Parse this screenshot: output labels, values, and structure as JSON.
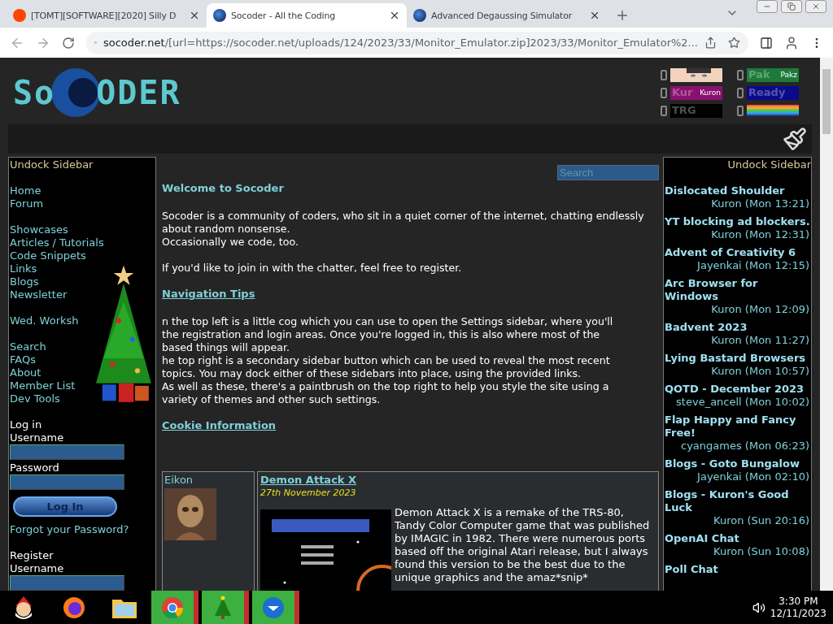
{
  "browser": {
    "tabs": [
      {
        "title": "[TOMT][SOFTWARE][2020] Silly D",
        "kind": "reddit",
        "selected": false
      },
      {
        "title": "Socoder - All the Coding",
        "kind": "socoder",
        "selected": true
      },
      {
        "title": "Advanced Degaussing Simulator",
        "kind": "socoder",
        "selected": false
      }
    ],
    "address": {
      "host": "socoder.net",
      "path": "/[url=https://socoder.net/uploads/124/2023/33/Monitor_Emulator.zip]2023/33/Monitor_Emulator%2..."
    }
  },
  "header": {
    "logo": {
      "left": "So",
      "right": "ODER"
    },
    "badges": [
      {
        "kind": "picture"
      },
      {
        "kind": "label",
        "main": "Pak",
        "sub": "Pakz",
        "color": "#1e7a3a"
      },
      {
        "kind": "label",
        "main": "Kur",
        "sub": "Kuron",
        "color": "#8a1070"
      },
      {
        "kind": "label",
        "main": "Ready",
        "color": "#0a0a8a"
      },
      {
        "kind": "label",
        "main": "TRG",
        "color": "#000000"
      },
      {
        "kind": "gradient"
      }
    ]
  },
  "left_sidebar": {
    "undock": "Undock Sidebar",
    "groups": [
      [
        "Home",
        "Forum"
      ],
      [
        "Showcases",
        "Articles / Tutorials",
        "Code Snippets",
        "Links",
        "Blogs",
        "Newsletter"
      ],
      [
        "Wed. Worksh"
      ],
      [
        "Search",
        "FAQs",
        "About",
        "Member List",
        "Dev Tools"
      ]
    ],
    "login": {
      "title": "Log in",
      "username_label": "Username",
      "password_label": "Password",
      "button": "Log In",
      "forgot": "Forgot your Password?"
    },
    "register": {
      "title": "Register",
      "username_label": "Username"
    }
  },
  "main": {
    "search": {
      "placeholder": "Search"
    },
    "welcome": {
      "heading": "Welcome to Socoder",
      "lines": [
        "Socoder is a community of coders, who sit in a quiet corner of the internet, chatting endlessly about random nonsense.",
        "Occasionally we code, too."
      ],
      "join": "If you'd like to join in with the chatter, feel free to register."
    },
    "tips": {
      "heading": "Navigation Tips",
      "lines": [
        "n the top left is a little cog which you can use to open the Settings sidebar, where you'll",
        "the registration and login areas. Once you're logged in, this is also where most of the",
        "based things will appear.",
        "he top right is a secondary sidebar button which can be used to reveal the most recent",
        "topics. You may dock either of these sidebars into place, using the provided links.",
        "As well as these, there's a paintbrush on the top right to help you style the site using a",
        "variety of themes and other such settings."
      ]
    },
    "cookie": {
      "heading": "Cookie Information"
    },
    "post": {
      "author": "Eikon",
      "title": "Demon Attack X",
      "date": "27th November 2023",
      "body": "Demon Attack X is a remake of the TRS-80, Tandy Color Computer game that was published by IMAGIC in 1982. There were numerous ports based off the original Atari release, but I always found this version to be the best due to the unique graphics and the amaz*snip*"
    }
  },
  "right_sidebar": {
    "undock": "Undock Sidebar",
    "topics": [
      {
        "title": "Dislocated Shoulder",
        "by": "Kuron (Mon 13:21)"
      },
      {
        "title": "YT blocking ad blockers.",
        "by": "Kuron (Mon 12:31)"
      },
      {
        "title": "Advent of Creativity 6",
        "by": "Jayenkai (Mon 12:15)"
      },
      {
        "title": "Arc Browser for Windows",
        "by": "Kuron (Mon 12:09)"
      },
      {
        "title": "Badvent 2023",
        "by": "Kuron (Mon 11:27)"
      },
      {
        "title": "Lying Bastard Browsers",
        "by": "Kuron (Mon 10:57)"
      },
      {
        "title": "QOTD - December 2023",
        "by": "steve_ancell (Mon 10:02)"
      },
      {
        "title": "Flap Happy and Fancy Free!",
        "by": "cyangames (Mon 06:23)"
      },
      {
        "title": "Blogs - Goto Bungalow",
        "by": "Jayenkai (Mon 02:10)"
      },
      {
        "title": "Blogs - Kuron's Good Luck",
        "by": "Kuron (Sun 20:16)"
      },
      {
        "title": "OpenAI Chat",
        "by": "Kuron (Sun 10:08)"
      },
      {
        "title": "Poll Chat"
      }
    ]
  },
  "taskbar": {
    "apps": [
      {
        "kind": "santa",
        "running": false
      },
      {
        "kind": "firefox",
        "running": false
      },
      {
        "kind": "folder",
        "running": false
      },
      {
        "kind": "chrome",
        "running": true
      },
      {
        "kind": "tree",
        "running": true
      },
      {
        "kind": "bird",
        "running": true
      }
    ],
    "time": "3:30 PM",
    "date": "12/11/2023"
  }
}
